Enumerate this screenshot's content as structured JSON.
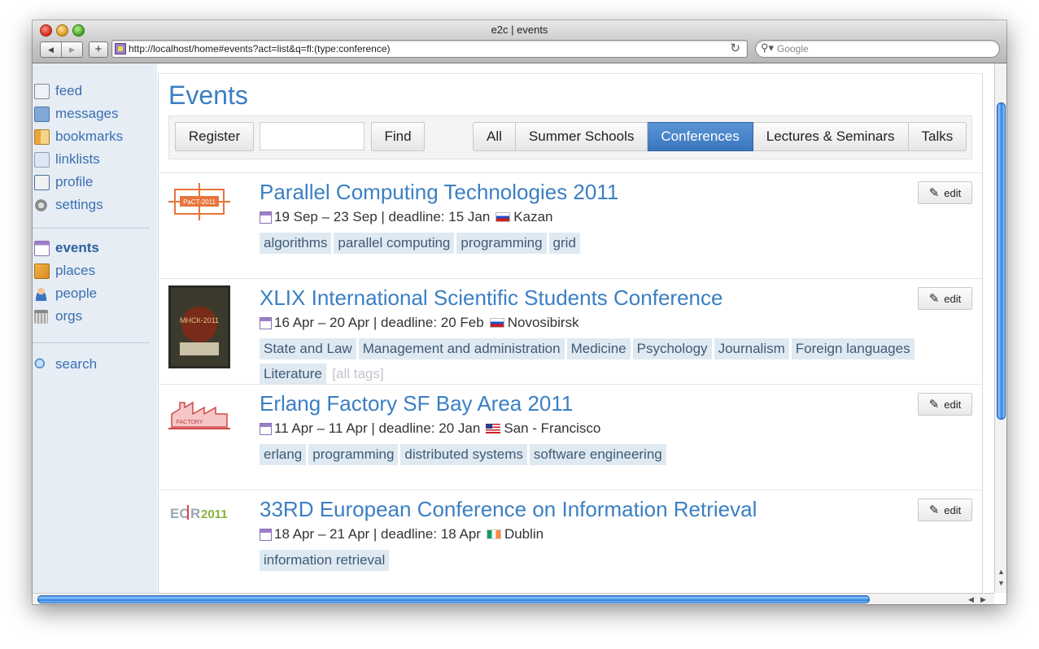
{
  "window": {
    "title": "e2c | events",
    "url": "http://localhost/home#events?act=list&q=fl:(type:conference)",
    "search_placeholder": "Google"
  },
  "sidebar": {
    "items": [
      {
        "label": "feed",
        "icon": "feed-icon"
      },
      {
        "label": "messages",
        "icon": "messages-icon"
      },
      {
        "label": "bookmarks",
        "icon": "bookmarks-icon"
      },
      {
        "label": "linklists",
        "icon": "linklists-icon"
      },
      {
        "label": "profile",
        "icon": "profile-icon"
      },
      {
        "label": "settings",
        "icon": "gear-icon"
      },
      {
        "label": "events",
        "icon": "calendar-icon",
        "active": true
      },
      {
        "label": "places",
        "icon": "places-icon"
      },
      {
        "label": "people",
        "icon": "person-icon"
      },
      {
        "label": "orgs",
        "icon": "building-icon"
      },
      {
        "label": "search",
        "icon": "search-icon"
      }
    ]
  },
  "page": {
    "title": "Events",
    "register_label": "Register",
    "search_value": "",
    "find_label": "Find",
    "filter_tabs": [
      "All",
      "Summer Schools",
      "Conferences",
      "Lectures & Seminars",
      "Talks"
    ],
    "active_tab": "Conferences"
  },
  "events": [
    {
      "title": "Parallel Computing Technologies 2011",
      "dates": "19 Sep – 23 Sep | deadline: 15 Jan",
      "country_flag": "flag-ru",
      "location": "Kazan",
      "tags": [
        "algorithms",
        "parallel computing",
        "programming",
        "grid"
      ],
      "edit_label": "edit",
      "logo_text": "PaCT-2011"
    },
    {
      "title": "XLIX International Scientific Students Conference",
      "dates": "16 Apr – 20 Apr | deadline: 20 Feb",
      "country_flag": "flag-ru",
      "location": "Novosibirsk",
      "tags": [
        "State and Law",
        "Management and administration",
        "Medicine",
        "Psychology",
        "Journalism",
        "Foreign languages",
        "Literature"
      ],
      "more_tags": "[all tags]",
      "edit_label": "edit",
      "logo_text": "МНСК-2011"
    },
    {
      "title": "Erlang Factory SF Bay Area 2011",
      "dates": "11 Apr – 11 Apr | deadline: 20 Jan",
      "country_flag": "flag-us",
      "location": "San - Francisco",
      "tags": [
        "erlang",
        "programming",
        "distributed systems",
        "software engineering"
      ],
      "edit_label": "edit",
      "logo_text": "FACTORY"
    },
    {
      "title": "33RD European Conference on Information Retrieval",
      "dates": "18 Apr – 21 Apr | deadline: 18 Apr",
      "country_flag": "flag-ie",
      "location": "Dublin",
      "tags": [
        "information retrieval"
      ],
      "edit_label": "edit",
      "logo_text": "ECIR 2011"
    }
  ]
}
